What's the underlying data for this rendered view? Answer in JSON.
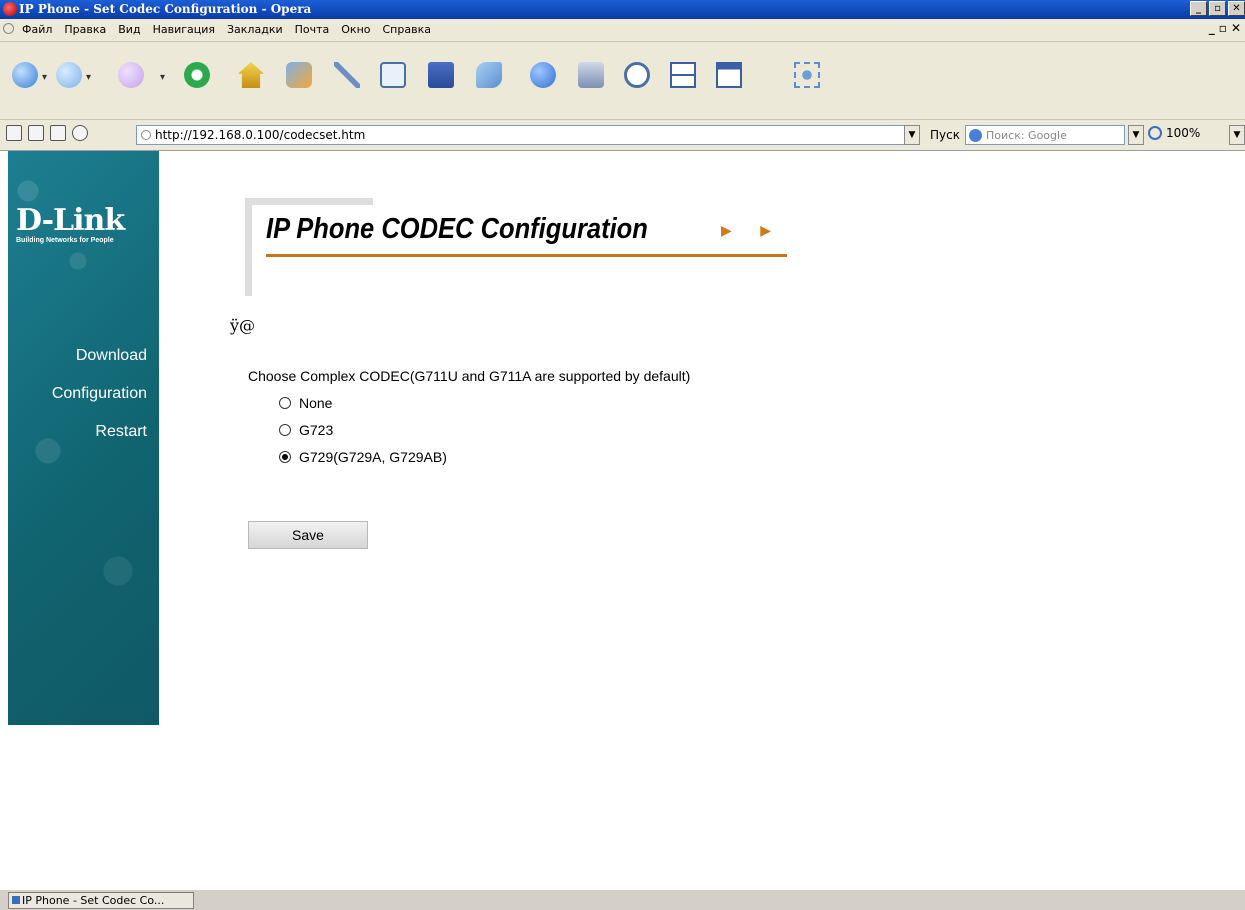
{
  "window": {
    "title": "IP Phone - Set Codec Configuration - Opera",
    "controls": [
      "_",
      "▫",
      "✕"
    ]
  },
  "menu": {
    "items": [
      "Файл",
      "Правка",
      "Вид",
      "Навигация",
      "Закладки",
      "Почта",
      "Окно",
      "Справка"
    ]
  },
  "toolbar": {
    "icons": [
      "back-icon",
      "forward-icon",
      "fast-forward-icon",
      "reload-icon",
      "home-icon",
      "hotlist-icon",
      "notes-icon",
      "print-preview-icon",
      "mail-icon",
      "chat-icon",
      "transfers-icon",
      "print-icon",
      "find-icon",
      "tile-icon",
      "cascade-icon",
      "fullscreen-icon"
    ]
  },
  "address": {
    "url": "http://192.168.0.100/codecset.htm",
    "go_label": "Пуск",
    "search_placeholder": "Поиск: Google",
    "zoom": "100%"
  },
  "sidebar": {
    "brand": "D-Link",
    "tagline": "Building Networks for People",
    "nav": [
      "Download",
      "Configuration",
      "Restart"
    ]
  },
  "main": {
    "title": "IP Phone  CODEC Configuration",
    "title_arrows": "▶ ▶",
    "garbled_text": "ÿ@",
    "codec_label": "Choose Complex CODEC(G711U and G711A are supported by default)",
    "options": [
      {
        "label": "None",
        "checked": false
      },
      {
        "label": "G723",
        "checked": false
      },
      {
        "label": "G729(G729A, G729AB)",
        "checked": true
      }
    ],
    "save_label": "Save"
  },
  "taskbar": {
    "item": "IP Phone - Set Codec Co..."
  },
  "colors": {
    "title_blue": "#0a3ba7",
    "sidebar_teal": "#10636f",
    "accent_orange": "#c87418"
  }
}
